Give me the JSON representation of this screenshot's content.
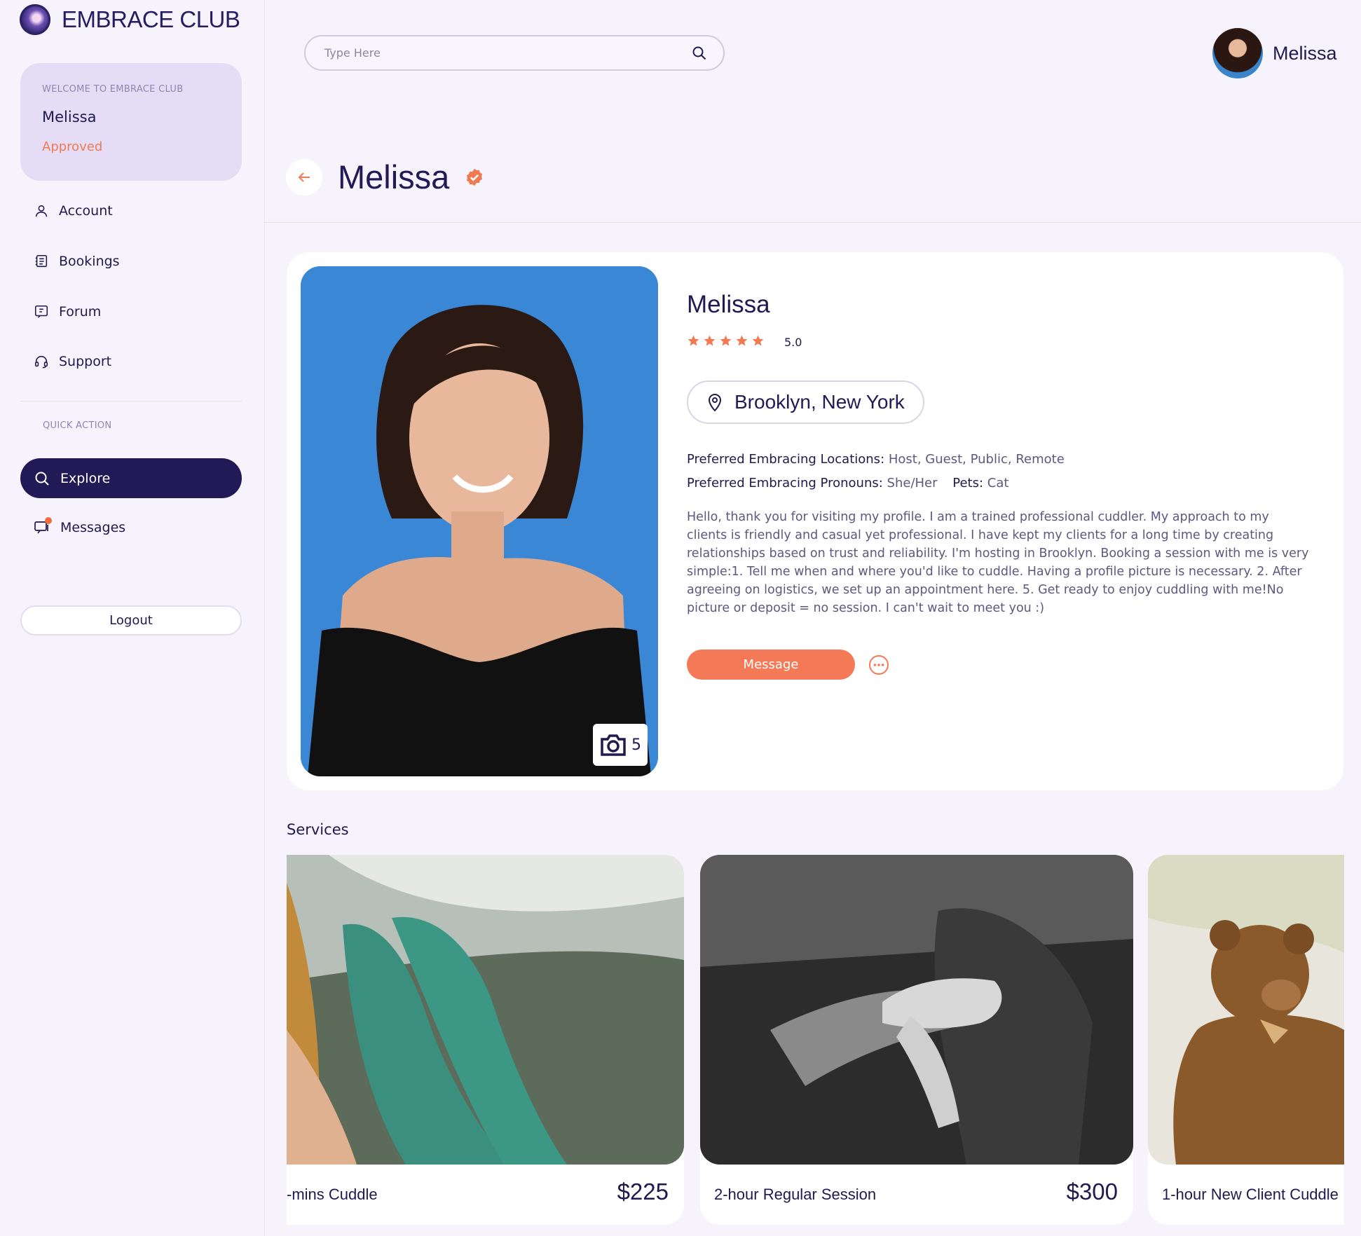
{
  "brand": {
    "name": "EMBRACE CLUB"
  },
  "sidebar": {
    "welcome_label": "WELCOME TO EMBRACE CLUB",
    "user_name": "Melissa",
    "status": "Approved",
    "nav": [
      {
        "label": "Account",
        "icon": "user-icon"
      },
      {
        "label": "Bookings",
        "icon": "bookings-icon"
      },
      {
        "label": "Forum",
        "icon": "forum-icon"
      },
      {
        "label": "Support",
        "icon": "headset-icon"
      }
    ],
    "quick_action_label": "QUICK ACTION",
    "explore_label": "Explore",
    "messages_label": "Messages",
    "logout_label": "Logout"
  },
  "header": {
    "search_placeholder": "Type Here",
    "user_name": "Melissa"
  },
  "page": {
    "title": "Melissa"
  },
  "profile": {
    "name": "Melissa",
    "rating": "5.0",
    "stars": 5,
    "location": "Brooklyn, New York",
    "locations_label": "Preferred Embracing Locations:",
    "locations_value": "Host, Guest, Public, Remote",
    "pronouns_label": "Preferred Embracing Pronouns:",
    "pronouns_value": "She/Her",
    "pets_label": "Pets:",
    "pets_value": "Cat",
    "bio": "Hello, thank you for visiting my profile. I am a trained professional cuddler. My approach to my clients is friendly and casual yet professional. I have kept my clients for a long time by creating relationships based on trust and reliability. I'm hosting in Brooklyn. Booking a session with me is very simple:1. Tell me when and where you'd like to cuddle. Having a profile picture is necessary. 2. After agreeing on logistics, we set up an appointment here. 5. Get ready to enjoy cuddling with me!No picture or deposit = no session. I can't wait to meet you :)",
    "message_label": "Message",
    "photo_count": "5"
  },
  "services": {
    "title": "Services",
    "items": [
      {
        "name": "-mins Cuddle",
        "price": "$225"
      },
      {
        "name": "2-hour Regular Session",
        "price": "$300"
      },
      {
        "name": "1-hour New Client Cuddle",
        "price": ""
      }
    ]
  },
  "colors": {
    "primary": "#211a57",
    "accent": "#f47a57",
    "background": "#f7f3fc",
    "welcome_card": "#e5ddf6"
  }
}
